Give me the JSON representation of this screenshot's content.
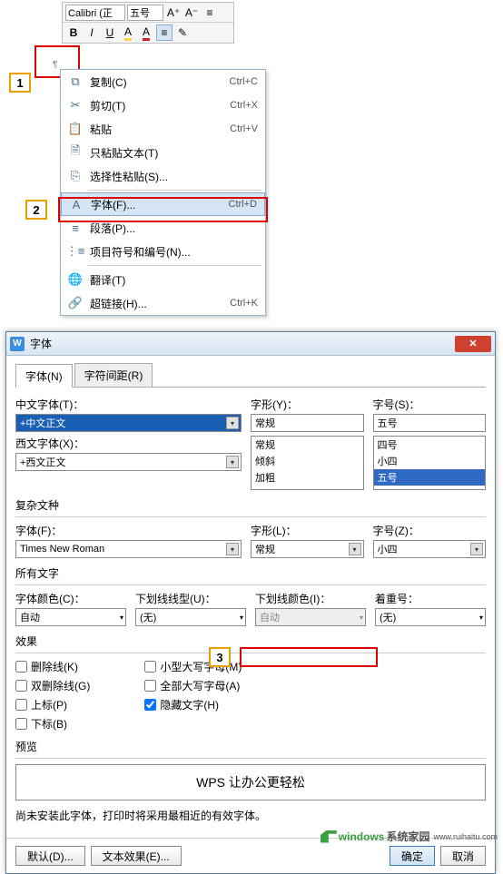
{
  "toolbar": {
    "font": "Calibri (正",
    "size": "五号",
    "grow": "A⁺",
    "shrink": "A⁻",
    "bold": "B",
    "italic": "I",
    "underline": "U"
  },
  "callouts": {
    "n1": "1",
    "n2": "2",
    "n3": "3"
  },
  "menu": {
    "copy": {
      "label": "复制(C)",
      "shortcut": "Ctrl+C"
    },
    "cut": {
      "label": "剪切(T)",
      "shortcut": "Ctrl+X"
    },
    "paste": {
      "label": "粘贴",
      "shortcut": "Ctrl+V"
    },
    "pastetext": {
      "label": "只粘贴文本(T)"
    },
    "pastespecial": {
      "label": "选择性粘贴(S)..."
    },
    "font": {
      "label": "字体(F)...",
      "shortcut": "Ctrl+D"
    },
    "paragraph": {
      "label": "段落(P)..."
    },
    "bullets": {
      "label": "项目符号和编号(N)..."
    },
    "translate": {
      "label": "翻译(T)"
    },
    "hyperlink": {
      "label": "超链接(H)...",
      "shortcut": "Ctrl+K"
    }
  },
  "dialog": {
    "title": "字体",
    "tabs": {
      "font": "字体(N)",
      "spacing": "字符间距(R)"
    },
    "cjkfont_label": "中文字体(T)：",
    "cjkfont_value": "+中文正文",
    "style_label": "字形(Y)：",
    "style_value": "常规",
    "style_options": [
      "常规",
      "倾斜",
      "加粗"
    ],
    "size_label": "字号(S)：",
    "size_value": "五号",
    "size_options": [
      "四号",
      "小四",
      "五号"
    ],
    "latinfont_label": "西文字体(X)：",
    "latinfont_value": "+西文正文",
    "complex_title": "复杂文种",
    "complex_font_label": "字体(F)：",
    "complex_font_value": "Times New Roman",
    "complex_style_label": "字形(L)：",
    "complex_style_value": "常规",
    "complex_size_label": "字号(Z)：",
    "complex_size_value": "小四",
    "allchars_title": "所有文字",
    "fontcolor_label": "字体颜色(C)：",
    "fontcolor_value": "自动",
    "underline_label": "下划线线型(U)：",
    "underline_value": "(无)",
    "ulcolor_label": "下划线颜色(I)：",
    "ulcolor_value": "自动",
    "emphasis_label": "着重号：",
    "emphasis_value": "(无)",
    "effects_title": "效果",
    "chk_strike": "删除线(K)",
    "chk_dstrike": "双删除线(G)",
    "chk_super": "上标(P)",
    "chk_sub": "下标(B)",
    "chk_smallcaps": "小型大写字母(M)",
    "chk_allcaps": "全部大写字母(A)",
    "chk_hidden": "隐藏文字(H)",
    "preview_title": "预览",
    "preview_text": "WPS 让办公更轻松",
    "note": "尚未安装此字体，打印时将采用最相近的有效字体。",
    "btn_default": "默认(D)...",
    "btn_texteffect": "文本效果(E)...",
    "btn_ok": "确定",
    "btn_cancel": "取消"
  },
  "watermark": {
    "brand": "windows",
    "sub": "系统家园",
    "url": "www.ruihaitu.com"
  }
}
